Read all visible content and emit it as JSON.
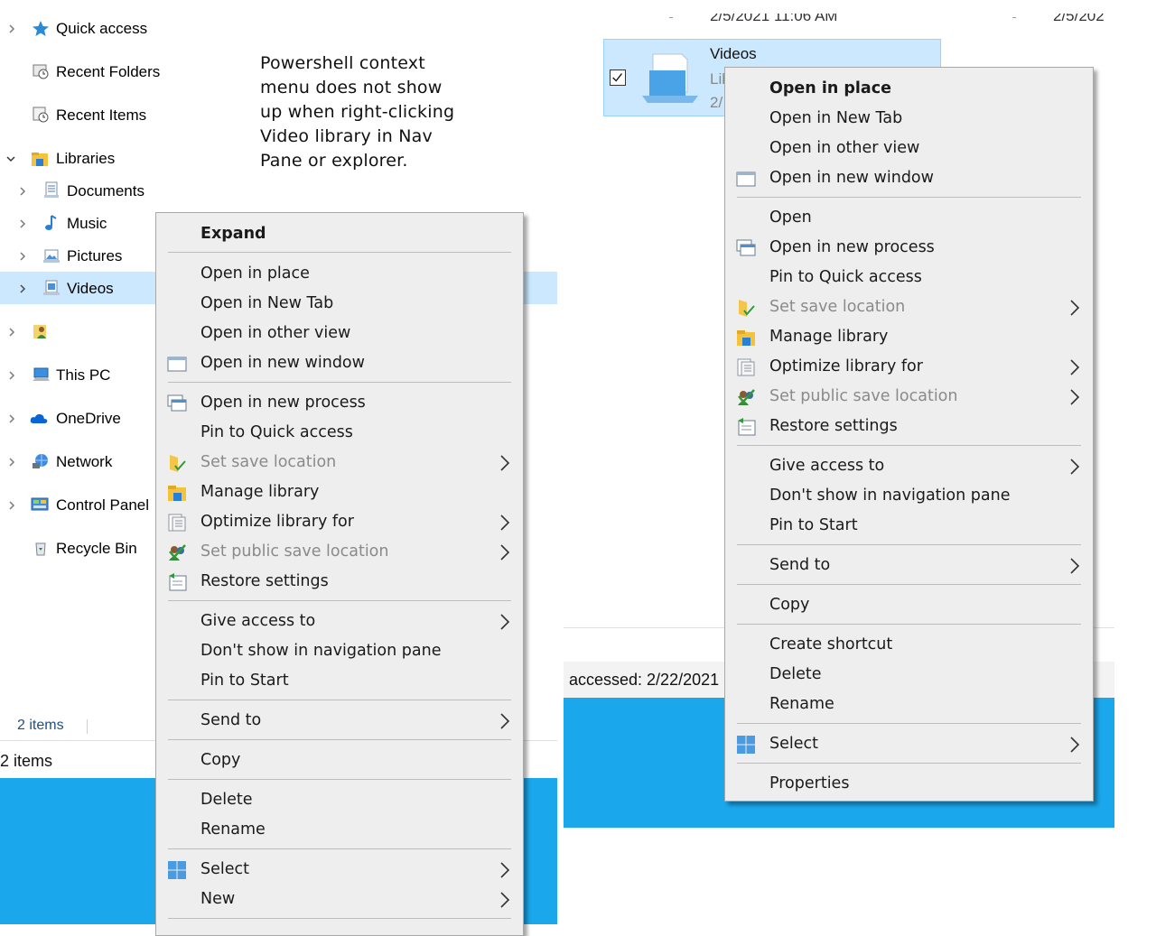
{
  "nav": {
    "items": [
      {
        "label": "Quick access"
      },
      {
        "label": "Recent Folders"
      },
      {
        "label": "Recent Items"
      },
      {
        "label": "Libraries"
      },
      {
        "label": "Documents"
      },
      {
        "label": "Music"
      },
      {
        "label": "Pictures"
      },
      {
        "label": "Videos"
      },
      {
        "label": ""
      },
      {
        "label": "This PC"
      },
      {
        "label": "OneDrive"
      },
      {
        "label": "Network"
      },
      {
        "label": "Control Panel"
      },
      {
        "label": "Recycle Bin"
      }
    ]
  },
  "note": {
    "lines": [
      "Powershell context",
      "menu does not show",
      "up when right-clicking",
      "Video library in Nav",
      "Pane or explorer."
    ]
  },
  "status": {
    "count_small": "2 items",
    "count_large": "2 items",
    "accessed": "accessed: 2/22/2021"
  },
  "top_right": {
    "date_left": "2/5/2021 11:06 AM",
    "date_right": "2/5/202"
  },
  "file_item": {
    "name": "Videos",
    "type_partial": "Lib",
    "date_partial": "2/"
  },
  "menu_left": {
    "items": [
      {
        "label": "Expand"
      },
      {
        "label": "Open in place"
      },
      {
        "label": "Open in New Tab"
      },
      {
        "label": "Open in other view"
      },
      {
        "label": "Open in new window"
      },
      {
        "label": "Open in new process"
      },
      {
        "label": "Pin to Quick access"
      },
      {
        "label": "Set save location"
      },
      {
        "label": "Manage library"
      },
      {
        "label": "Optimize library for"
      },
      {
        "label": "Set public save location"
      },
      {
        "label": "Restore settings"
      },
      {
        "label": "Give access to"
      },
      {
        "label": "Don't show in navigation pane"
      },
      {
        "label": "Pin to Start"
      },
      {
        "label": "Send to"
      },
      {
        "label": "Copy"
      },
      {
        "label": "Delete"
      },
      {
        "label": "Rename"
      },
      {
        "label": "Select"
      },
      {
        "label": "New"
      }
    ]
  },
  "menu_right": {
    "items": [
      {
        "label": "Open in place"
      },
      {
        "label": "Open in New Tab"
      },
      {
        "label": "Open in other view"
      },
      {
        "label": "Open in new window"
      },
      {
        "label": "Open"
      },
      {
        "label": "Open in new process"
      },
      {
        "label": "Pin to Quick access"
      },
      {
        "label": "Set save location"
      },
      {
        "label": "Manage library"
      },
      {
        "label": "Optimize library for"
      },
      {
        "label": "Set public save location"
      },
      {
        "label": "Restore settings"
      },
      {
        "label": "Give access to"
      },
      {
        "label": "Don't show in navigation pane"
      },
      {
        "label": "Pin to Start"
      },
      {
        "label": "Send to"
      },
      {
        "label": "Copy"
      },
      {
        "label": "Create shortcut"
      },
      {
        "label": "Delete"
      },
      {
        "label": "Rename"
      },
      {
        "label": "Select"
      },
      {
        "label": "Properties"
      }
    ]
  },
  "colors": {
    "selection": "#cce8ff",
    "desktop_blue": "#1aa7ec",
    "menu_bg": "#eeeeee"
  }
}
